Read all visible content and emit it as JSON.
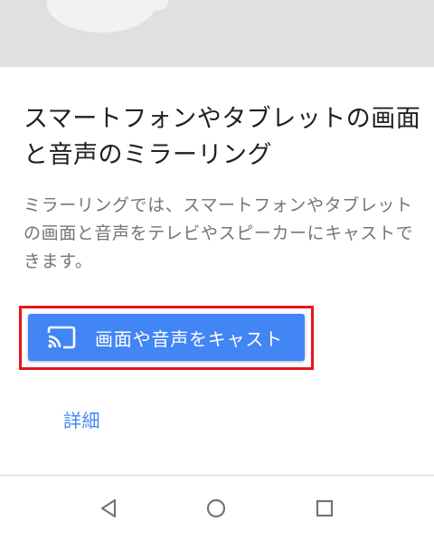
{
  "hero": {
    "illustration_icon": "device-illustration",
    "background": "#e0e0e0"
  },
  "content": {
    "title": "スマートフォンやタブレットの画面と音声のミラーリング",
    "description": "ミラーリングでは、スマートフォンやタブレットの画面と音声をテレビやスピーカーにキャストできます。"
  },
  "cast_button": {
    "label": "画面や音声をキャスト",
    "icon": "cast-icon",
    "color": "#4285f4",
    "highlight_color": "#e8141b"
  },
  "details_link": {
    "label": "詳細",
    "color": "#4285f4"
  },
  "navigation_bar": {
    "buttons": [
      "back-icon",
      "home-icon",
      "recent-apps-icon"
    ]
  }
}
